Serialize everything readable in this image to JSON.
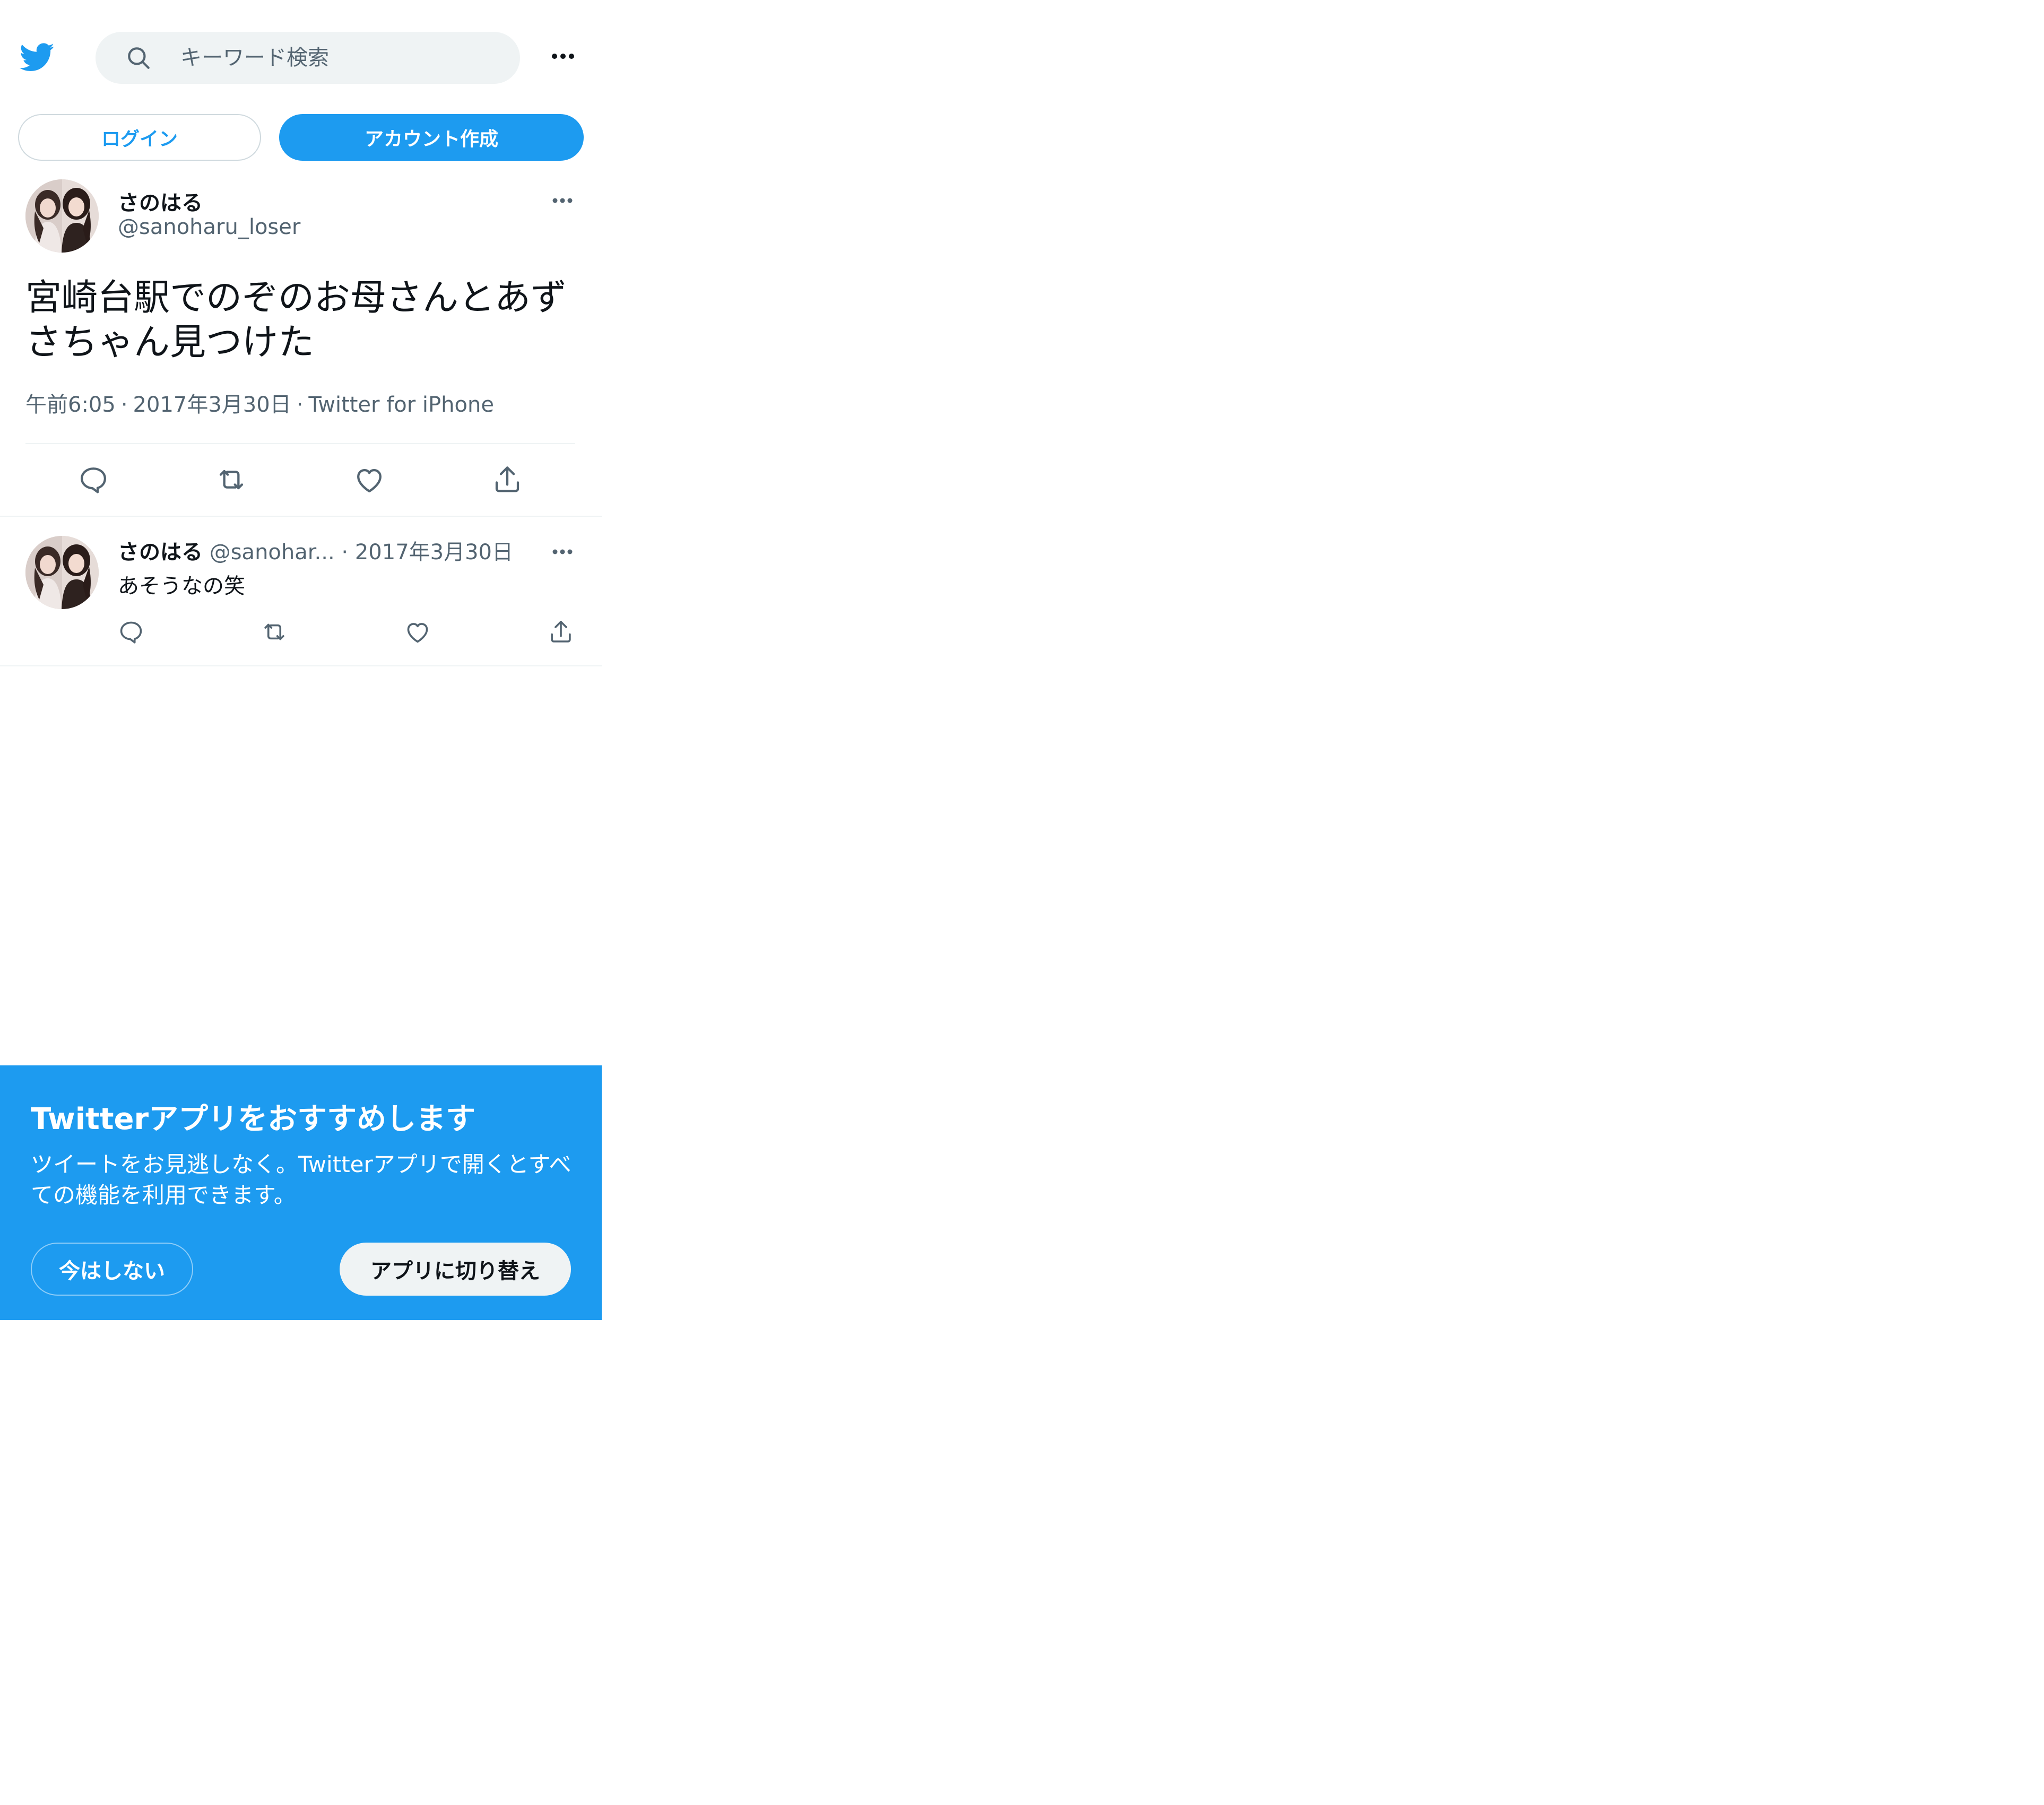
{
  "header": {
    "logo_icon": "twitter-bird-icon",
    "search_icon": "search-icon",
    "search_placeholder": "キーワード検索",
    "more_icon": "more-horizontal-icon"
  },
  "auth": {
    "login_label": "ログイン",
    "signup_label": "アカウント作成"
  },
  "main_tweet": {
    "display_name": "さのはる",
    "handle": "@sanoharu_loser",
    "text": "宮崎台駅でのぞのお母さんとあずさちゃん見つけた",
    "time": "午前6:05",
    "date": "2017年3月30日",
    "source": "Twitter for iPhone",
    "separator": "·",
    "actions": [
      "reply-icon",
      "retweet-icon",
      "like-icon",
      "share-icon"
    ]
  },
  "reply_tweet": {
    "display_name": "さのはる",
    "handle": "@sanohar...",
    "separator": "·",
    "date": "2017年3月30日",
    "text": "あそうなの笑",
    "actions": [
      "reply-icon",
      "retweet-icon",
      "like-icon",
      "share-icon"
    ]
  },
  "promo": {
    "title": "Twitterアプリをおすすめします",
    "body": "ツイートをお見逃しなく。Twitterアプリで開くとすべての機能を利用できます。",
    "not_now_label": "今はしない",
    "switch_label": "アプリに切り替え"
  },
  "colors": {
    "brand": "#1d9bf0",
    "text_primary": "#0f1419",
    "text_secondary": "#536471",
    "divider": "#eff3f4",
    "search_bg": "#eff3f4"
  }
}
